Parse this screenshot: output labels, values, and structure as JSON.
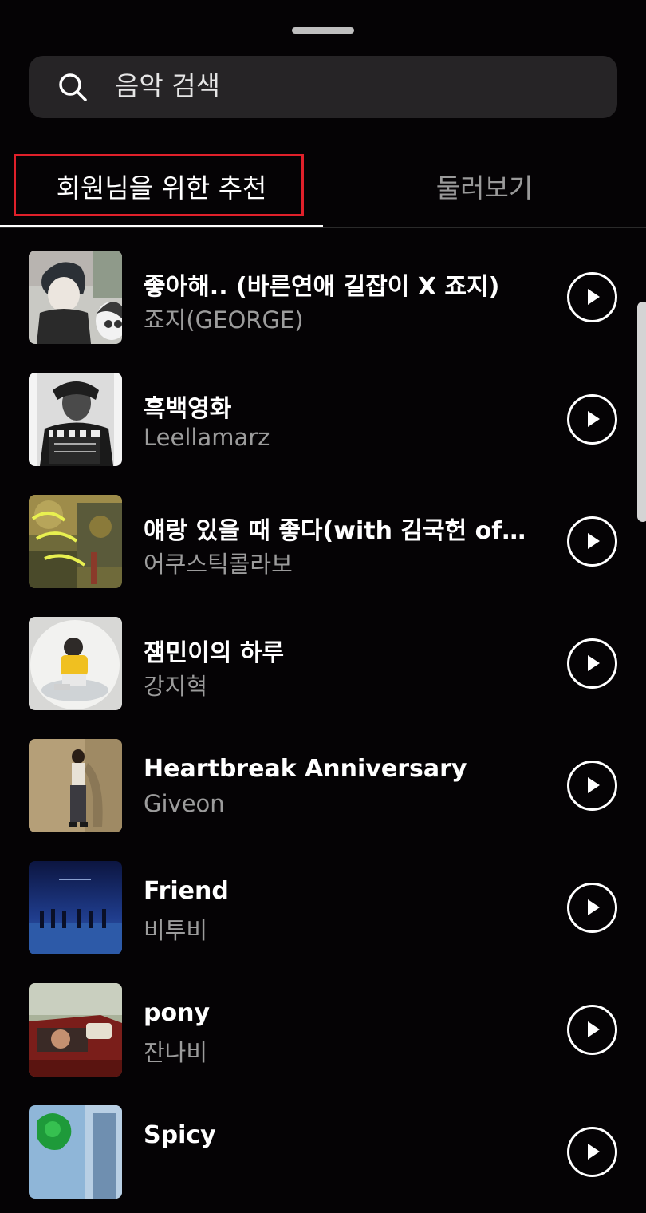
{
  "search": {
    "placeholder": "음악 검색"
  },
  "tabs": [
    {
      "label": "회원님을 위한 추천",
      "active": true
    },
    {
      "label": "둘러보기",
      "active": false
    }
  ],
  "tracks": [
    {
      "title": "좋아해.. (바른연애 길잡이 X 죠지)",
      "artist": "죠지(GEORGE)"
    },
    {
      "title": "흑백영화",
      "artist": "Leellamarz"
    },
    {
      "title": "얘랑 있을 때 좋다(with 김국헌 of 비…",
      "artist": "어쿠스틱콜라보"
    },
    {
      "title": "잼민이의 하루",
      "artist": "강지혁"
    },
    {
      "title": "Heartbreak Anniversary",
      "artist": "Giveon"
    },
    {
      "title": "Friend",
      "artist": "비투비"
    },
    {
      "title": "pony",
      "artist": "잔나비"
    },
    {
      "title": "Spicy",
      "artist": ""
    }
  ],
  "colors": {
    "background": "#050305",
    "search_bg": "#262426",
    "highlight": "#e0202a",
    "inactive_tab": "#9a9a9a",
    "artist_text": "#9c9c9c"
  }
}
